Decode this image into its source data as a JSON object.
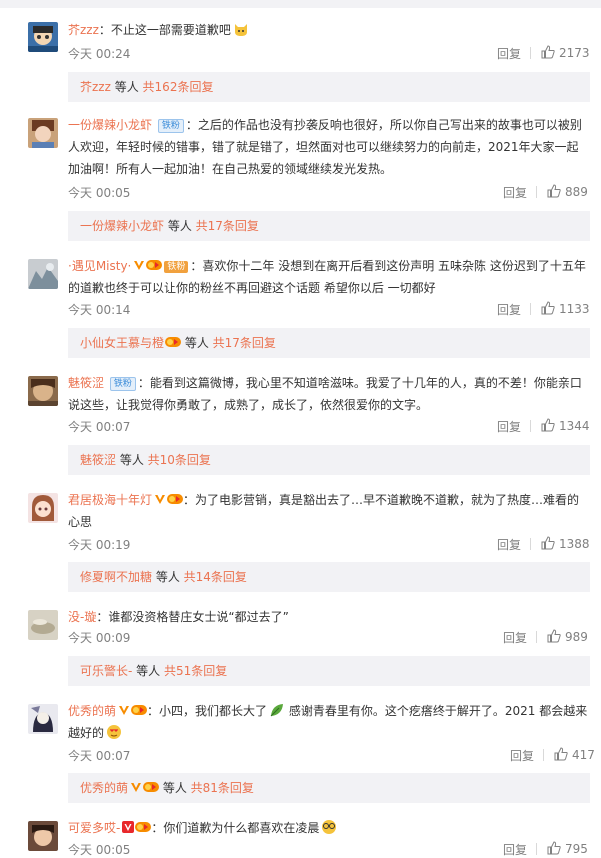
{
  "colors": {
    "link": "#eb7350",
    "meta": "#808080",
    "panel": "#f2f2f5",
    "vip_orange": "#f78c00",
    "text": "#333333"
  },
  "icons": {
    "like": "thumbs-up-icon",
    "verified": "v-verified-icon",
    "level": "vip-level-icon"
  },
  "comments": [
    {
      "user": "芥zzz",
      "sep": "：",
      "text": "不止这一部需要道歉吧",
      "time": "今天 00:24",
      "reply": "回复",
      "likes": "2173",
      "sub_user": "芥zzz",
      "sub_mid": " 等人 ",
      "sub_total": "共162条回复"
    },
    {
      "user": "一份爆辣小龙虾",
      "badge": "铁粉",
      "sep": "：",
      "text": "之后的作品也没有抄袭反响也很好，所以你自己写出来的故事也可以被别人欢迎，年轻时候的错事，错了就是错了，坦然面对也可以继续努力的向前走，2021年大家一起加油啊！所有人一起加油！在自己热爱的领域继续发光发热。",
      "time": "今天 00:05",
      "reply": "回复",
      "likes": "889",
      "sub_user": "一份爆辣小龙虾",
      "sub_mid": " 等人 ",
      "sub_total": "共17条回复"
    },
    {
      "user": "·遇见Misty·",
      "gold": "铁粉",
      "sep": "：",
      "text": "喜欢你十二年 没想到在离开后看到这份声明 五味杂陈 这份迟到了十五年的道歉也终于可以让你的粉丝不再回避这个话题 希望你以后 一切都好",
      "time": "今天 00:14",
      "reply": "回复",
      "likes": "1133",
      "sub_user": "小仙女王慕与橙",
      "sub_mid": " 等人 ",
      "sub_total": "共17条回复"
    },
    {
      "user": "魅筱涩",
      "badge": "铁粉",
      "sep": "：",
      "text": "能看到这篇微博，我心里不知道啥滋味。我爱了十几年的人，真的不差！你能亲口说这些，让我觉得你勇敢了，成熟了，成长了，依然很爱你的文字。",
      "time": "今天 00:07",
      "reply": "回复",
      "likes": "1344",
      "sub_user": "魅筱涩",
      "sub_mid": " 等人 ",
      "sub_total": "共10条回复"
    },
    {
      "user": "君居极海十年灯",
      "sep": "：",
      "text": "为了电影营销，真是豁出去了…早不道歉晚不道歉，就为了热度…难看的心思",
      "time": "今天 00:19",
      "reply": "回复",
      "likes": "1388",
      "sub_user": "修夏啊不加糖",
      "sub_mid": " 等人 ",
      "sub_total": "共14条回复"
    },
    {
      "user": "没-璇",
      "sep": "：",
      "text": "谁都没资格替庄女士说“都过去了”",
      "time": "今天 00:09",
      "reply": "回复",
      "likes": "989",
      "sub_user": "可乐警长-",
      "sub_mid": " 等人 ",
      "sub_total": "共51条回复"
    },
    {
      "user": "优秀的萌",
      "sep": "：",
      "text": "小四，我们都长大了",
      "text2": "感谢青春里有你。这个疙瘩终于解开了。2021 都会越来越好的",
      "time": "今天 00:07",
      "reply": "回复",
      "likes": "417",
      "sub_user": "优秀的萌",
      "sub_mid": " 等人 ",
      "sub_total": "共81条回复"
    },
    {
      "user": "可爱多哎-",
      "sep": "：",
      "text": "你们道歉为什么都喜欢在凌晨",
      "time": "今天 00:05",
      "reply": "回复",
      "likes": "795"
    }
  ]
}
